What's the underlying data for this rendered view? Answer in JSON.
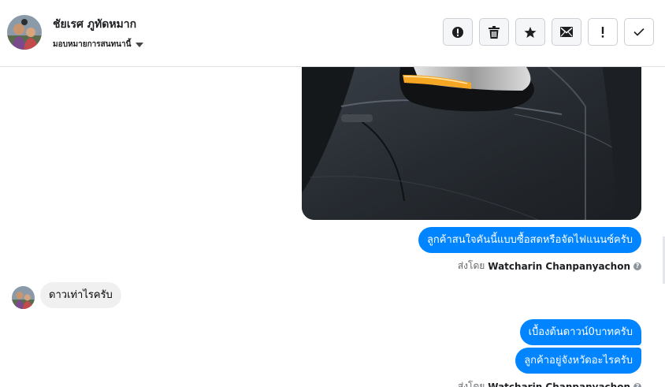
{
  "header": {
    "contact_name": "ชัยเรศ ภูทัดหมาก",
    "assign_label": "มอบหมายการสนทนานี้",
    "toolbar": [
      {
        "name": "spam-button",
        "icon": "alert-circle-icon"
      },
      {
        "name": "delete-button",
        "icon": "trash-icon"
      },
      {
        "name": "star-button",
        "icon": "star-icon"
      },
      {
        "name": "mark-unread-button",
        "icon": "envelope-icon"
      },
      {
        "name": "follow-up-button",
        "icon": "exclamation-icon"
      },
      {
        "name": "mark-done-button",
        "icon": "check-icon"
      }
    ]
  },
  "messages": {
    "out_1": "ลูกค้าสนใจคันนี้แบบซื้อสดหรือจัดไฟแนนซ์ครับ",
    "in_1": "ดาวเท่าไรครับ",
    "out_2": "เบื้องต้นดาวน์0บาทครับ",
    "out_3": "ลูกค้าอยู่จังหวัดอะไรครับ"
  },
  "sent_by": {
    "prefix": "ส่งโดย",
    "name": "Watcharin Chanpanyachon",
    "help": "?"
  },
  "colors": {
    "outgoing_bubble": "#0084ff",
    "incoming_bubble": "#f0f0f0",
    "border": "#dddfe2"
  }
}
